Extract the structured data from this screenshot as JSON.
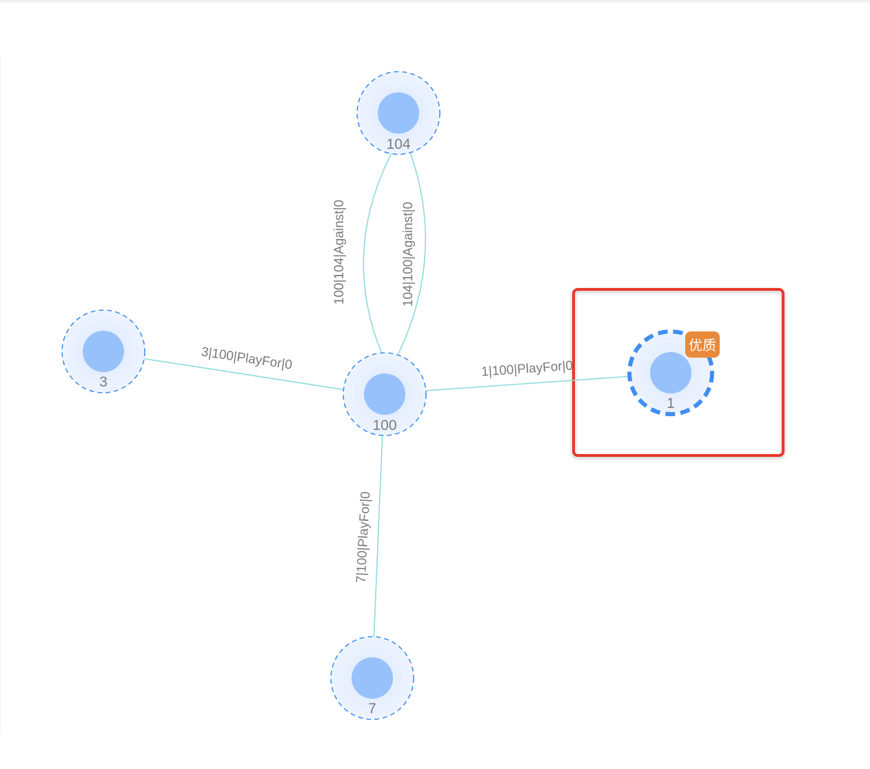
{
  "graph": {
    "nodes": [
      {
        "id": "104",
        "label": "104",
        "selected": false
      },
      {
        "id": "100",
        "label": "100",
        "selected": false
      },
      {
        "id": "3",
        "label": "3",
        "selected": false
      },
      {
        "id": "7",
        "label": "7",
        "selected": false
      },
      {
        "id": "1",
        "label": "1",
        "selected": true,
        "badge": "优质"
      }
    ],
    "edges": [
      {
        "source": "100",
        "target": "104",
        "label": "100|104|Against|0"
      },
      {
        "source": "104",
        "target": "100",
        "label": "104|100|Against|0"
      },
      {
        "source": "3",
        "target": "100",
        "label": "3|100|PlayFor|0"
      },
      {
        "source": "1",
        "target": "100",
        "label": "1|100|PlayFor|0"
      },
      {
        "source": "7",
        "target": "100",
        "label": "7|100|PlayFor|0"
      }
    ]
  },
  "colors": {
    "node_fill": "#97c1fb",
    "node_halo": "#e6efff",
    "node_ring": "#3f8ef0",
    "edge": "#8fd9db",
    "badge": "#e88a3c",
    "highlight_box": "#e8392c"
  }
}
